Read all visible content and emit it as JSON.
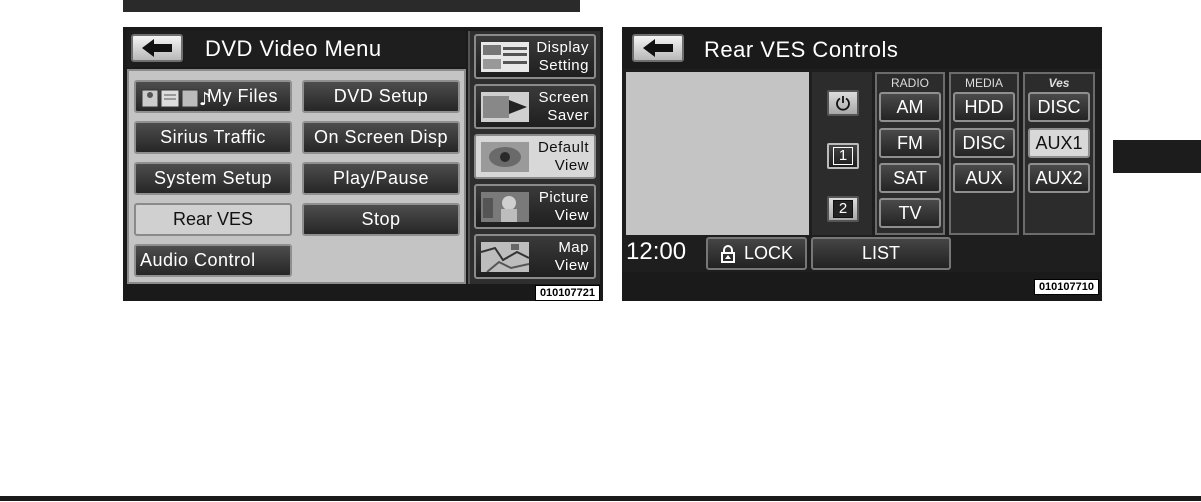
{
  "screen1": {
    "title": "DVD Video Menu",
    "menu_left": [
      "My Files",
      "Sirius Traffic",
      "System Setup",
      "Rear VES",
      "Audio Control"
    ],
    "menu_right": [
      "DVD Setup",
      "On Screen Disp",
      "Play/Pause",
      "Stop"
    ],
    "selected": "Rear VES",
    "side_buttons": [
      {
        "label": "Display Setting",
        "line1": "Display",
        "line2": "Setting",
        "icon": "display-setting-thumbnail"
      },
      {
        "label": "Screen Saver",
        "line1": "Screen",
        "line2": "Saver",
        "icon": "screen-saver-thumbnail"
      },
      {
        "label": "Default View",
        "line1": "Default",
        "line2": "View",
        "icon": "default-view-thumbnail",
        "selected": true
      },
      {
        "label": "Picture View",
        "line1": "Picture",
        "line2": "View",
        "icon": "picture-view-thumbnail"
      },
      {
        "label": "Map View",
        "line1": "Map",
        "line2": "View",
        "icon": "map-view-thumbnail"
      }
    ],
    "code": "010107721"
  },
  "screen2": {
    "title": "Rear VES Controls",
    "columns": {
      "radio": {
        "header": "RADIO",
        "items": [
          "AM",
          "FM",
          "SAT",
          "TV"
        ]
      },
      "media": {
        "header": "MEDIA",
        "items": [
          "HDD",
          "DISC",
          "AUX"
        ]
      },
      "ves": {
        "header": "Ves",
        "items": [
          "DISC",
          "AUX1",
          "AUX2"
        ]
      }
    },
    "selected_ves": "AUX1",
    "channel_buttons": [
      "1",
      "2"
    ],
    "power_icon": "power-icon",
    "clock": "12:00",
    "lock_label": "LOCK",
    "list_label": "LIST",
    "code": "010107710"
  }
}
